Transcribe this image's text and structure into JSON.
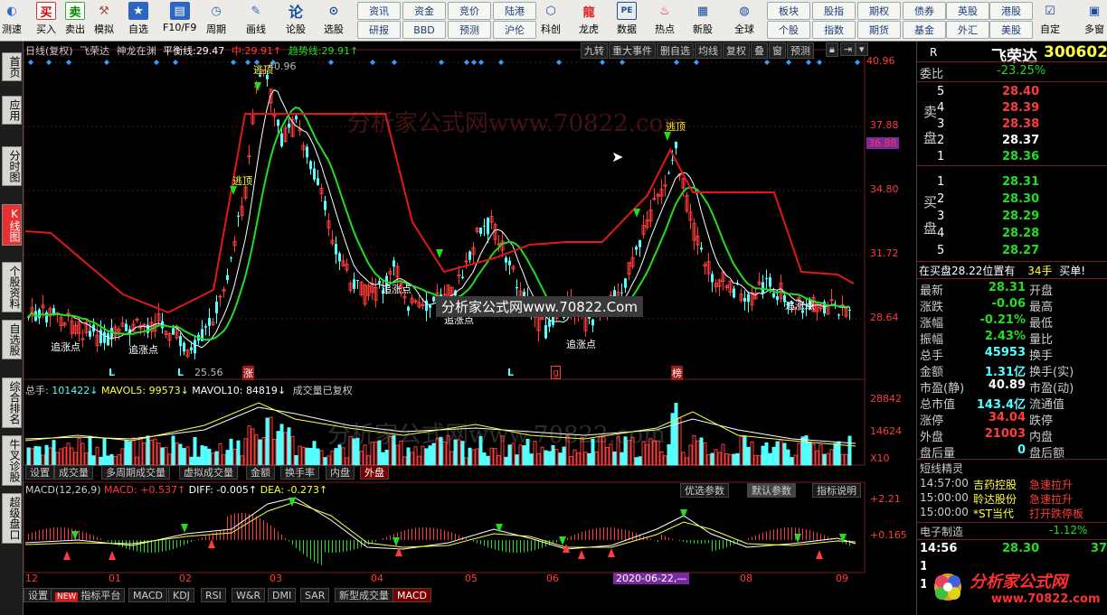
{
  "toolbar": {
    "items": [
      {
        "label": "测速",
        "icon": "speed-icon"
      },
      {
        "label": "买入",
        "icon": "buy-icon",
        "glyph": "买"
      },
      {
        "label": "卖出",
        "icon": "sell-icon",
        "glyph": "卖"
      },
      {
        "label": "模拟",
        "icon": "hammer-icon"
      },
      {
        "label": "自选",
        "icon": "star-icon"
      },
      {
        "label": "F10/F9",
        "icon": "f10-icon"
      },
      {
        "label": "周期",
        "icon": "clock-icon"
      },
      {
        "label": "画线",
        "icon": "pen-icon"
      },
      {
        "label": "论股",
        "icon": "talk-icon",
        "glyph": "论"
      },
      {
        "label": "选股",
        "icon": "scan-icon"
      }
    ],
    "pill_buttons": [
      "资讯",
      "资金",
      "竞价",
      "陆港",
      "研报",
      "BBD",
      "预测",
      "沪伦"
    ],
    "items2": [
      {
        "label": "科创",
        "icon": "kechuang-icon"
      },
      {
        "label": "龙虎",
        "icon": "dragon-icon"
      },
      {
        "label": "数据",
        "icon": "data-icon"
      },
      {
        "label": "热点",
        "icon": "hot-icon"
      },
      {
        "label": "新股",
        "icon": "newstock-icon"
      },
      {
        "label": "全球",
        "icon": "globe-icon"
      }
    ],
    "pill_buttons2": [
      "板块",
      "股指",
      "期权",
      "债券",
      "英股",
      "港股",
      "个股",
      "指数",
      "期货",
      "基金",
      "外汇",
      "美股"
    ],
    "end_items": [
      {
        "label": "自定",
        "icon": "custom-icon"
      },
      {
        "label": "多窗",
        "icon": "multiwin-icon"
      }
    ]
  },
  "left_tabs": [
    {
      "label": "首页"
    },
    {
      "label": "应用"
    },
    {
      "label": "分时图"
    },
    {
      "label": "K线图",
      "active": true
    },
    {
      "label": "个股资料"
    },
    {
      "label": "自选股"
    },
    {
      "label": "综合排名"
    },
    {
      "label": "牛叉诊股"
    },
    {
      "label": "超级盘口"
    }
  ],
  "chart_header": {
    "period": "日线(复权)",
    "stock": "飞荣达",
    "indicator": "神龙在渊",
    "balance_label": "平衡线:",
    "balance_value": "29.47",
    "mid_label": "中:",
    "mid_value": "29.91",
    "trend_label": "趋势线:",
    "trend_value": "29.91",
    "right_buttons": [
      "九转",
      "重大事件",
      "删自选",
      "均线",
      "复权",
      "叠",
      "窗",
      "预测"
    ]
  },
  "price_axis": {
    "ticks": [
      "40.96",
      "37.88",
      "34.80",
      "31.72",
      "28.64"
    ],
    "current": "36.88"
  },
  "annotations": {
    "escape": [
      "逃顶",
      "逃顶",
      "逃顶"
    ],
    "chase": [
      "追涨点",
      "追涨点",
      "追涨点",
      "追涨点",
      "追涨点",
      "追涨点"
    ],
    "high": "40.96",
    "low": "25.56",
    "markers": [
      "L",
      "L",
      "涨",
      "L",
      "g",
      "榜"
    ]
  },
  "volume": {
    "total_label": "总手:",
    "total": "101422",
    "mavol5_label": "MAVOL5:",
    "mavol5": "99573",
    "mavol10_label": "MAVOL10:",
    "mavol10": "84819",
    "note": "成交量已复权",
    "axis": [
      "28842",
      "14624",
      "X10"
    ]
  },
  "vol_tabs": [
    "设置",
    "成交量",
    "多周期成交量",
    "虚拟成交量",
    "金额",
    "换手率",
    "内盘",
    "外盘"
  ],
  "macd": {
    "title": "MACD(12,26,9)",
    "macd_label": "MACD:",
    "macd": "+0.537",
    "diff_label": "DIFF:",
    "diff": "-0.005",
    "dea_label": "DEA:",
    "dea": "-0.273",
    "axis": [
      "+2.21",
      "+0.165"
    ],
    "buttons": [
      "优选参数",
      "默认参数",
      "指标说明"
    ]
  },
  "x_axis": {
    "labels": [
      "12",
      "01",
      "02",
      "03",
      "04",
      "05",
      "06",
      "07",
      "08",
      "09"
    ],
    "cursor_date": "2020-06-22,—"
  },
  "bottom_tabs": [
    "设置",
    "指标平台",
    "MACD",
    "KDJ",
    "RSI",
    "W&R",
    "DMI",
    "SAR",
    "新型成交量",
    "MACD"
  ],
  "new_badge": "NEW",
  "watermark": "分析家公式网www.70822.com",
  "watermark_small": "分析家公式网www.70822.Com",
  "logo_text": {
    "cn": "分析家公式网",
    "url": "www.70822.com"
  },
  "quote": {
    "r_label": "R",
    "name": "飞荣达",
    "code": "300602",
    "weibi_label": "委比",
    "weibi": "-23.25%",
    "sell_label": "卖盘",
    "buy_label": "买盘",
    "asks": [
      {
        "lvl": "5",
        "price": "28.40"
      },
      {
        "lvl": "4",
        "price": "28.39"
      },
      {
        "lvl": "3",
        "price": "28.38"
      },
      {
        "lvl": "2",
        "price": "28.37"
      },
      {
        "lvl": "1",
        "price": "28.36"
      }
    ],
    "bids": [
      {
        "lvl": "1",
        "price": "28.31"
      },
      {
        "lvl": "2",
        "price": "28.30"
      },
      {
        "lvl": "3",
        "price": "28.29"
      },
      {
        "lvl": "4",
        "price": "28.28"
      },
      {
        "lvl": "5",
        "price": "28.27"
      }
    ],
    "inside_note": "在买盘28.22位置有",
    "inside_hands": "34手",
    "inside_action": "买单!",
    "fields": [
      {
        "l": "最新",
        "v": "28.31",
        "l2": "开盘"
      },
      {
        "l": "涨跌",
        "v": "-0.06",
        "l2": "最高"
      },
      {
        "l": "涨幅",
        "v": "-0.21%",
        "l2": "最低"
      },
      {
        "l": "振幅",
        "v": "2.43%",
        "l2": "量比"
      },
      {
        "l": "总手",
        "v": "45953",
        "l2": "换手"
      },
      {
        "l": "金额",
        "v": "1.31亿",
        "l2": "换手(实)"
      },
      {
        "l": "市盈(静)",
        "v": "40.89",
        "l2": "市盈(动)"
      },
      {
        "l": "总市值",
        "v": "143.4亿",
        "l2": "流通值"
      },
      {
        "l": "涨停",
        "v": "34.04",
        "l2": "跌停"
      },
      {
        "l": "外盘",
        "v": "21003",
        "l2": "内盘"
      },
      {
        "l": "盘后量",
        "v": "0",
        "l2": "盘后额"
      }
    ],
    "spirit_title": "短线精灵",
    "spirit": [
      {
        "t": "14:57:00",
        "n": "吉药控股",
        "e": "急速拉升"
      },
      {
        "t": "15:00:00",
        "n": "聆达股份",
        "e": "急速拉升"
      },
      {
        "t": "15:00:00",
        "n": "*ST当代",
        "e": "打开跌停板"
      }
    ],
    "sector_name": "电子制造",
    "sector_chg": "-1.12%",
    "tick_time": "14:56",
    "tick_price": "28.30",
    "tick_vol": "37"
  },
  "colors": {
    "up": "#ff3c3c",
    "down": "#54ffff",
    "green_line": "#22dd22",
    "red_line": "#e01818",
    "white_line": "#ffffff",
    "yellow": "#ffff40"
  }
}
